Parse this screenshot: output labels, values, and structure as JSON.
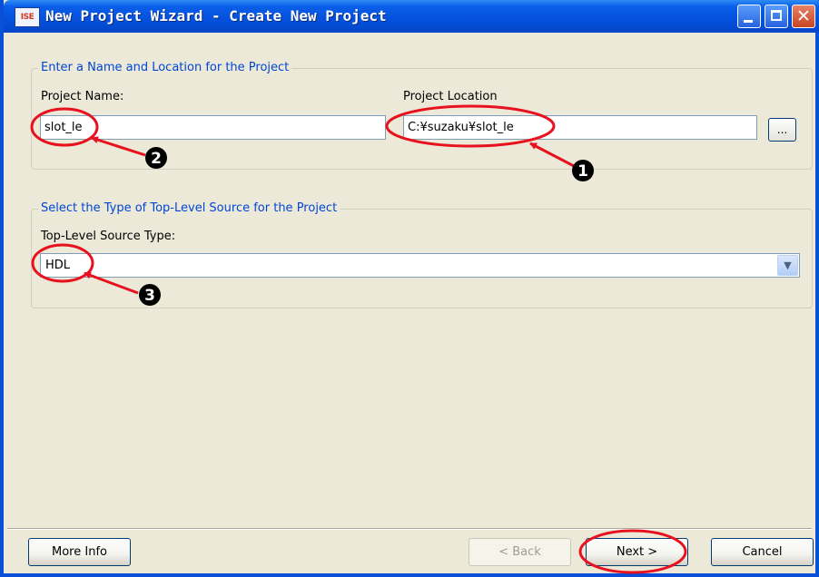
{
  "window": {
    "title": "New Project Wizard - Create New Project",
    "app_icon_text": "ISE"
  },
  "group_name_location": {
    "legend": "Enter a Name and Location for the Project",
    "project_name_label": "Project Name:",
    "project_name_value": "slot_le",
    "project_location_label": "Project Location",
    "project_location_value": "C:¥suzaku¥slot_le",
    "browse_label": "..."
  },
  "group_source_type": {
    "legend": "Select the Type of Top-Level Source for the Project",
    "source_type_label": "Top-Level Source Type:",
    "source_type_value": "HDL"
  },
  "buttons": {
    "more_info": "More Info",
    "back": "< Back",
    "next": "Next >",
    "cancel": "Cancel"
  },
  "annotations": {
    "marker_1": "1",
    "marker_2": "2",
    "marker_3": "3",
    "color": "#e8121f"
  }
}
